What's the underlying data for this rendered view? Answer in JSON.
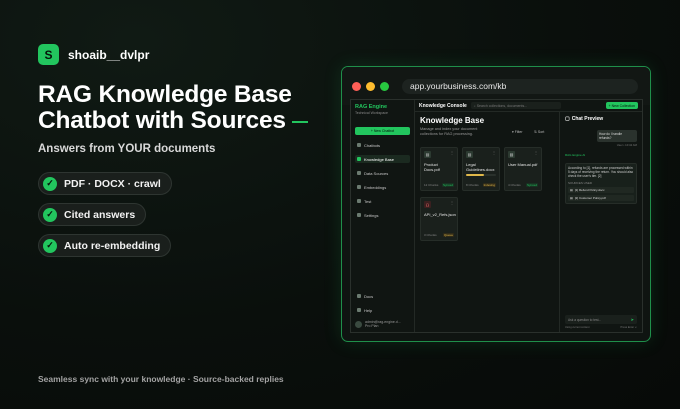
{
  "brand": {
    "logo_letter": "S",
    "name": "shoaib__dvlpr"
  },
  "headline": {
    "line1": "RAG Knowledge Base",
    "line2": "Chatbot with Sources"
  },
  "subline": "Answers from YOUR documents",
  "features": [
    "PDF · DOCX · crawl",
    "Cited answers",
    "Auto re-embedding"
  ],
  "footer": "Seamless sync with your knowledge  ·  Source-backed replies",
  "colors": {
    "accent": "#22c55e",
    "bg": "#0a0f0c"
  },
  "browser": {
    "url": "app.yourbusiness.com/kb"
  },
  "app": {
    "sidebar": {
      "title": "RAG Engine",
      "subtitle": "Technical Workspace",
      "new_button": "+ New Chatbot",
      "items": [
        "Chatbots",
        "Knowledge Base",
        "Data Sources",
        "Embeddings",
        "Test",
        "Settings"
      ],
      "bottom_items": [
        "Docs",
        "Help"
      ],
      "user_email": "admin@rag-engine.d...",
      "user_plan": "Pro Plan"
    },
    "topbar": {
      "title": "Knowledge Console",
      "search_placeholder": "Search collections, documents...",
      "new_button": "+ New Collection"
    },
    "kb": {
      "title": "Knowledge Base",
      "description": "Manage and index your document collections for RAG processing.",
      "filter_label": "Filter",
      "sort_label": "Sort",
      "cards": [
        {
          "name": "Product Docs.pdf",
          "meta": "12 Chunks",
          "status": "Synced"
        },
        {
          "name": "Legal Guidelines.docx",
          "meta": "8 Chunks",
          "status": "Indexing",
          "progress": 0.6
        },
        {
          "name": "User Manual.pdf",
          "meta": "4 Chunks",
          "status": "Synced"
        },
        {
          "name": "API_v2_Refs.json",
          "meta": "3 Chunks",
          "status": "Queue"
        }
      ]
    },
    "chat": {
      "title": "Chat Preview",
      "user_message": "How do I handle refunds?",
      "user_meta": "User • 10:42 AM",
      "bot_name": "RAG Engine AI",
      "bot_message": "According to [1], refunds are processed within 5 days of receiving the return. You should also check the user's tier. [2]",
      "sources_label": "SOURCES USED",
      "sources": [
        "[1] Refund Policy.docx",
        "[2] Customer Policy.pdf"
      ],
      "input_placeholder": "Ask a question to test...",
      "footer_left": "Using current context",
      "footer_right": "Press Enter ↵"
    }
  }
}
